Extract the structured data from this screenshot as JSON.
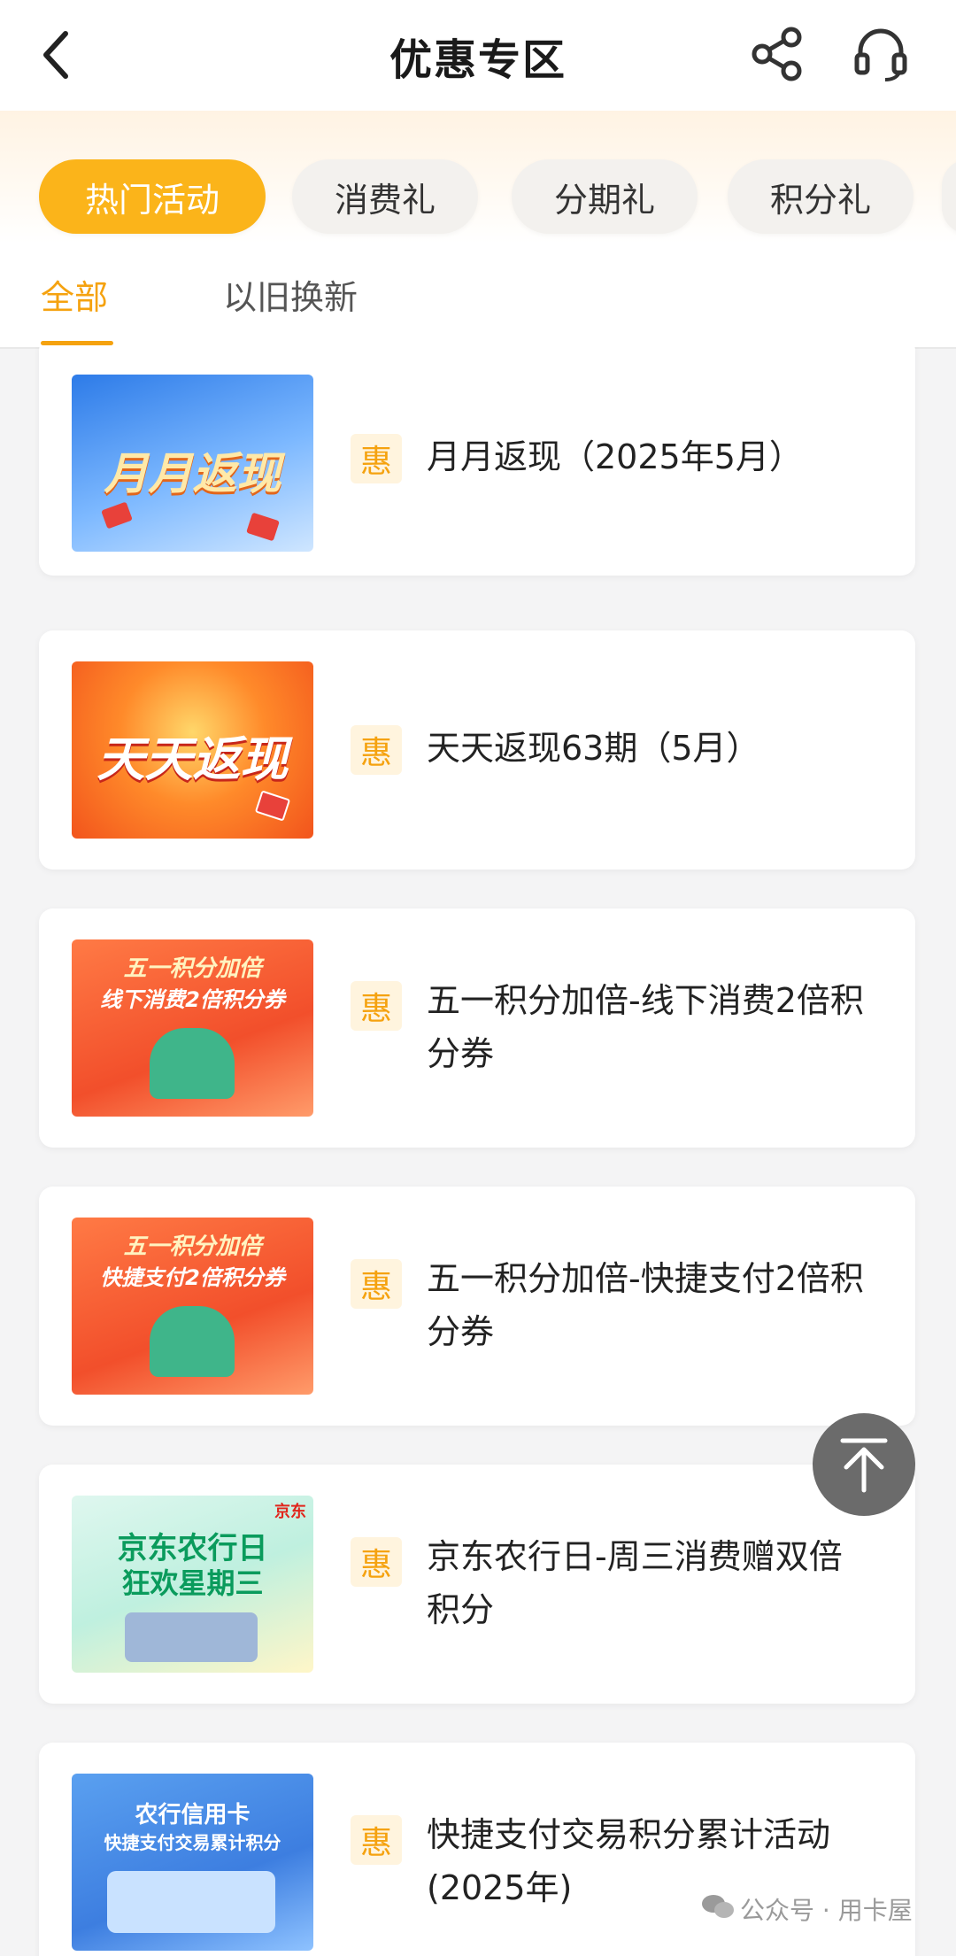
{
  "header": {
    "title": "优惠专区"
  },
  "categories": [
    {
      "label": "热门活动",
      "active": true
    },
    {
      "label": "消费礼",
      "active": false
    },
    {
      "label": "分期礼",
      "active": false
    },
    {
      "label": "积分礼",
      "active": false
    }
  ],
  "subtabs": [
    {
      "label": "全部",
      "active": true
    },
    {
      "label": "以旧换新",
      "active": false
    }
  ],
  "badge_label": "惠",
  "promotions": [
    {
      "title": "月月返现（2025年5月）",
      "thumb_text": "月月返现"
    },
    {
      "title": "天天返现63期（5月）",
      "thumb_text": "天天返现"
    },
    {
      "title": "五一积分加倍-线下消费2倍积分券",
      "thumb_line1": "五一积分加倍",
      "thumb_line2": "线下消费2倍积分券"
    },
    {
      "title": "五一积分加倍-快捷支付2倍积分券",
      "thumb_line1": "五一积分加倍",
      "thumb_line2": "快捷支付2倍积分券"
    },
    {
      "title": "京东农行日-周三消费赠双倍积分",
      "thumb_line1": "京东农行日",
      "thumb_line2": "狂欢星期三",
      "thumb_corner": "京东"
    },
    {
      "title": "快捷支付交易积分累计活动(2025年)",
      "thumb_line1": "农行信用卡",
      "thumb_line2": "快捷支付交易累计积分"
    }
  ],
  "watermark": "公众号 · 用卡屋",
  "colors": {
    "accent": "#fbb41a",
    "accent_text": "#f5a20f",
    "badge_bg": "#fff4de"
  }
}
